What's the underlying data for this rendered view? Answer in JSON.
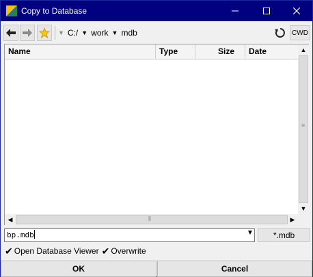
{
  "window": {
    "title": "Copy to Database",
    "icons": {
      "app": "app-icon",
      "minimize": "minimize-icon",
      "maximize": "maximize-icon",
      "close": "close-icon"
    }
  },
  "toolbar": {
    "back_icon": "back-arrow-icon",
    "forward_icon": "forward-arrow-icon",
    "favorites_icon": "star-icon",
    "refresh_icon": "refresh-icon",
    "cwd_label": "CWD"
  },
  "path": {
    "segments": [
      "C:/",
      "work",
      "mdb"
    ]
  },
  "file_list": {
    "columns": [
      "Name",
      "Type",
      "Size",
      "Date"
    ],
    "rows": []
  },
  "filename": {
    "value": "bp.mdb"
  },
  "filter": {
    "label": "*.mdb"
  },
  "options": {
    "open_viewer": {
      "label": "Open Database Viewer",
      "checked": true
    },
    "overwrite": {
      "label": "Overwrite",
      "checked": true
    }
  },
  "buttons": {
    "ok": "OK",
    "cancel": "Cancel"
  },
  "colors": {
    "titlebar": "#000080",
    "window_bg": "#f0f0f0",
    "favorites_star": "#f5c518"
  }
}
